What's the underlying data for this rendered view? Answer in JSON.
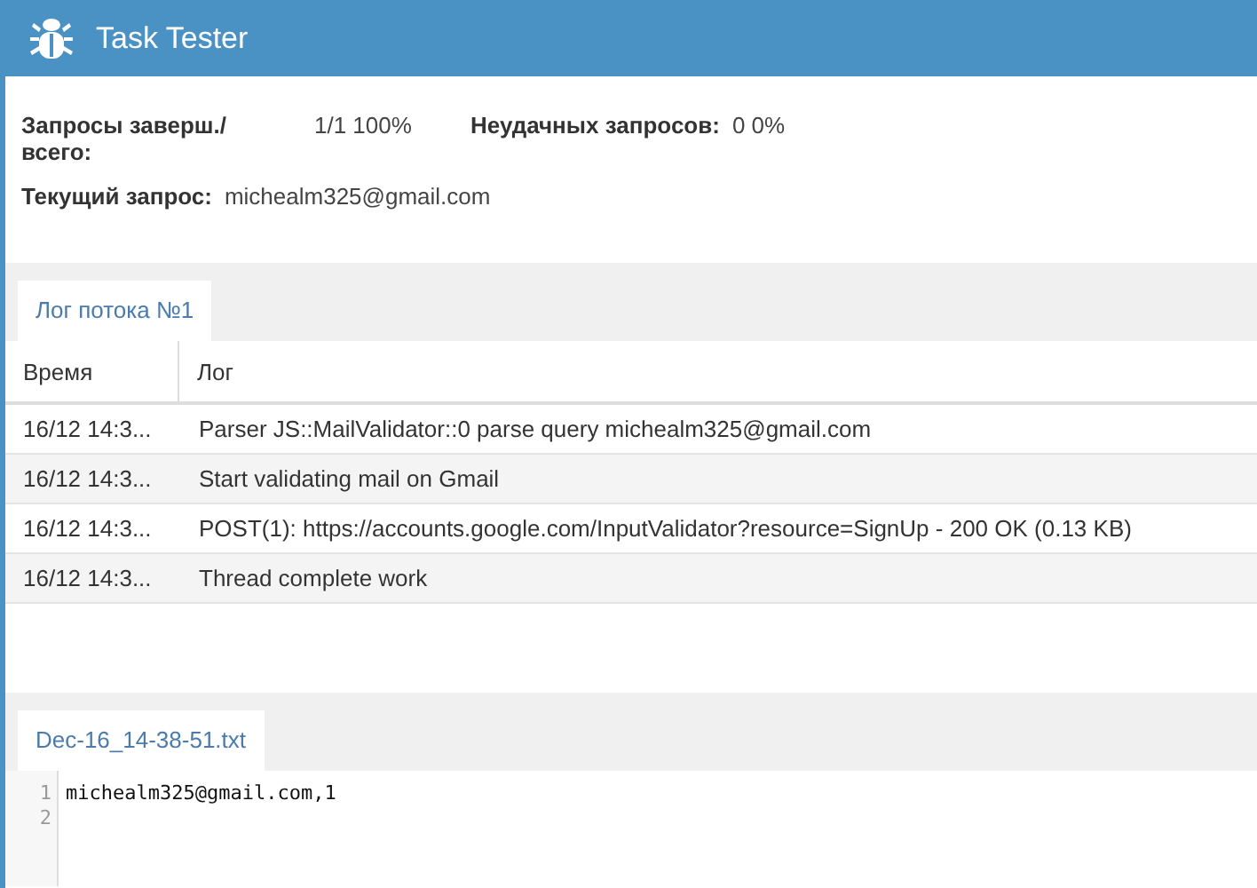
{
  "window": {
    "title": "Task Tester"
  },
  "stats": [
    {
      "label": "Запросы заверш./ всего:",
      "value": "1/1 100%"
    },
    {
      "label": "Неудачных запросов:",
      "value": "0 0%"
    }
  ],
  "current": {
    "label": "Текущий запрос:",
    "value": "michealm325@gmail.com"
  },
  "log_tabs": [
    {
      "label": "Лог потока №1",
      "selected": true
    }
  ],
  "table": {
    "columns": [
      "Время",
      "Лог"
    ],
    "rows": [
      {
        "time": "16/12 14:3...",
        "message": "Parser JS::MailValidator::0 parse query michealm325@gmail.com"
      },
      {
        "time": "16/12 14:3...",
        "message": "Start validating mail on Gmail"
      },
      {
        "time": "16/12 14:3...",
        "message": "POST(1): https://accounts.google.com/InputValidator?resource=SignUp - 200 OK (0.13 KB)"
      },
      {
        "time": "16/12 14:3...",
        "message": "Thread complete work"
      }
    ]
  },
  "file_tabs": [
    {
      "label": "Dec-16_14-38-51.txt",
      "selected": true
    }
  ],
  "editor": {
    "lines": [
      {
        "number": "1",
        "text": "michealm325@gmail.com,1"
      },
      {
        "number": "2"
      }
    ]
  }
}
